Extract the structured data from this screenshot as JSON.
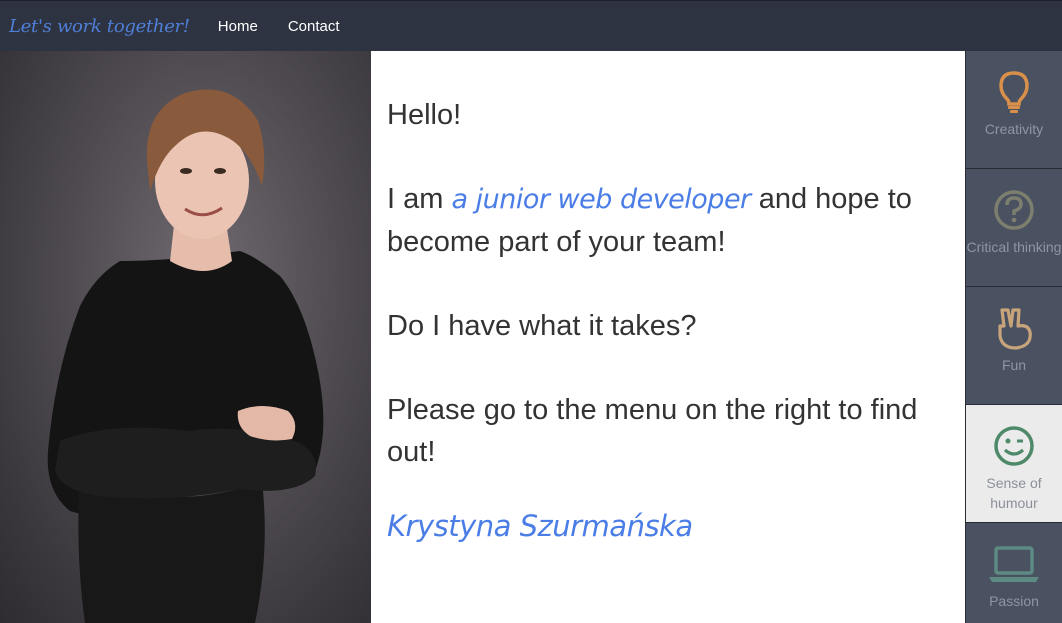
{
  "navbar": {
    "brand": "Let's work together!",
    "links": [
      {
        "label": "Home"
      },
      {
        "label": "Contact"
      }
    ]
  },
  "main": {
    "greeting": "Hello!",
    "intro_prefix": "I am ",
    "intro_highlight": "a junior web developer",
    "intro_suffix": " and hope to become part of your team!",
    "question": "Do I have what it takes?",
    "instruction": "Please go to the menu on the right to find out!",
    "signature": "Krystyna Szurmańska"
  },
  "sidebar": {
    "items": [
      {
        "label": "Creativity",
        "icon": "lightbulb-icon",
        "color": "#d9904a"
      },
      {
        "label": "Critical thinking",
        "icon": "question-circle-icon",
        "color": "#7d7f6e"
      },
      {
        "label": "Fun",
        "icon": "hand-peace-icon",
        "color": "#c8a47a"
      },
      {
        "label": "Sense of humour",
        "icon": "smile-wink-icon",
        "color": "#4e8a6a",
        "active": true
      },
      {
        "label": "Passion",
        "icon": "laptop-icon",
        "color": "#5d8a82"
      }
    ]
  }
}
